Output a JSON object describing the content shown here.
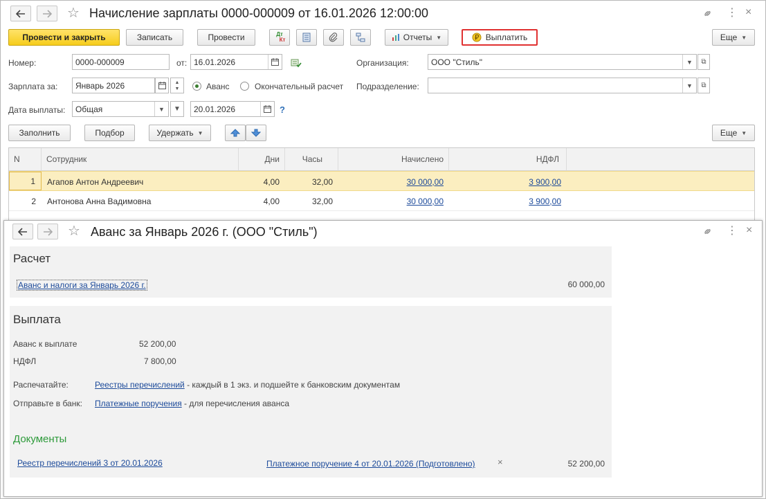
{
  "main": {
    "title": "Начисление зарплаты 0000-000009 от 16.01.2026 12:00:00",
    "nav": {
      "back": "🡐",
      "forward": "🡒"
    },
    "toolbar": {
      "post_close": "Провести и закрыть",
      "write": "Записать",
      "post": "Провести",
      "dt_kt_top": "Дт",
      "dt_kt_bottom": "Кт",
      "reports": "Отчеты",
      "pay": "Выплатить",
      "more": "Еще"
    },
    "form": {
      "number_label": "Номер:",
      "number_value": "0000-000009",
      "from_label": "от:",
      "from_value": "16.01.2026",
      "org_label": "Организация:",
      "org_value": "ООО \"Стиль\"",
      "salary_for_label": "Зарплата за:",
      "salary_for_value": "Январь 2026",
      "radio_advance": "Аванс",
      "radio_final": "Окончательный расчет",
      "dept_label": "Подразделение:",
      "dept_value": "",
      "pay_date_label": "Дата выплаты:",
      "pay_type_value": "Общая",
      "pay_date_value": "20.01.2026",
      "help": "?"
    },
    "table_toolbar": {
      "fill": "Заполнить",
      "pick": "Подбор",
      "withhold": "Удержать",
      "more": "Еще"
    },
    "table": {
      "headers": [
        "N",
        "Сотрудник",
        "Дни",
        "Часы",
        "Начислено",
        "НДФЛ"
      ],
      "rows": [
        {
          "n": "1",
          "employee": "Агапов Антон Андреевич",
          "days": "4,00",
          "hours": "32,00",
          "accrued": "30 000,00",
          "ndfl": "3 900,00"
        },
        {
          "n": "2",
          "employee": "Антонова Анна Вадимовна",
          "days": "4,00",
          "hours": "32,00",
          "accrued": "30 000,00",
          "ndfl": "3 900,00"
        }
      ]
    }
  },
  "sub": {
    "title": "Аванс за Январь 2026 г. (ООО \"Стиль\")",
    "calc": {
      "heading": "Расчет",
      "link": "Аванс и налоги за Январь 2026 г.",
      "amount": "60 000,00"
    },
    "payout": {
      "heading": "Выплата",
      "advance_label": "Аванс к выплате",
      "advance_value": "52 200,00",
      "ndfl_label": "НДФЛ",
      "ndfl_value": "7 800,00",
      "print_label": "Распечатайте:",
      "print_link": "Реестры перечислений",
      "print_text": " - каждый в 1 экз. и подшейте к банковским документам",
      "send_label": "Отправьте в банк:",
      "send_link": "Платежные поручения",
      "send_text": " - для перечисления аванса"
    },
    "documents": {
      "heading": "Документы",
      "registry": "Реестр перечислений 3 от 20.01.2026",
      "order": "Платежное поручение 4 от 20.01.2026 (Подготовлено)",
      "remove": "×",
      "amount": "52 200,00"
    }
  },
  "icons": {
    "star": "☆",
    "link": "🔗",
    "menu": "⋮",
    "close": "×",
    "calendar": "📅",
    "dropdown": "▾",
    "up": "▲",
    "down": "▼"
  }
}
